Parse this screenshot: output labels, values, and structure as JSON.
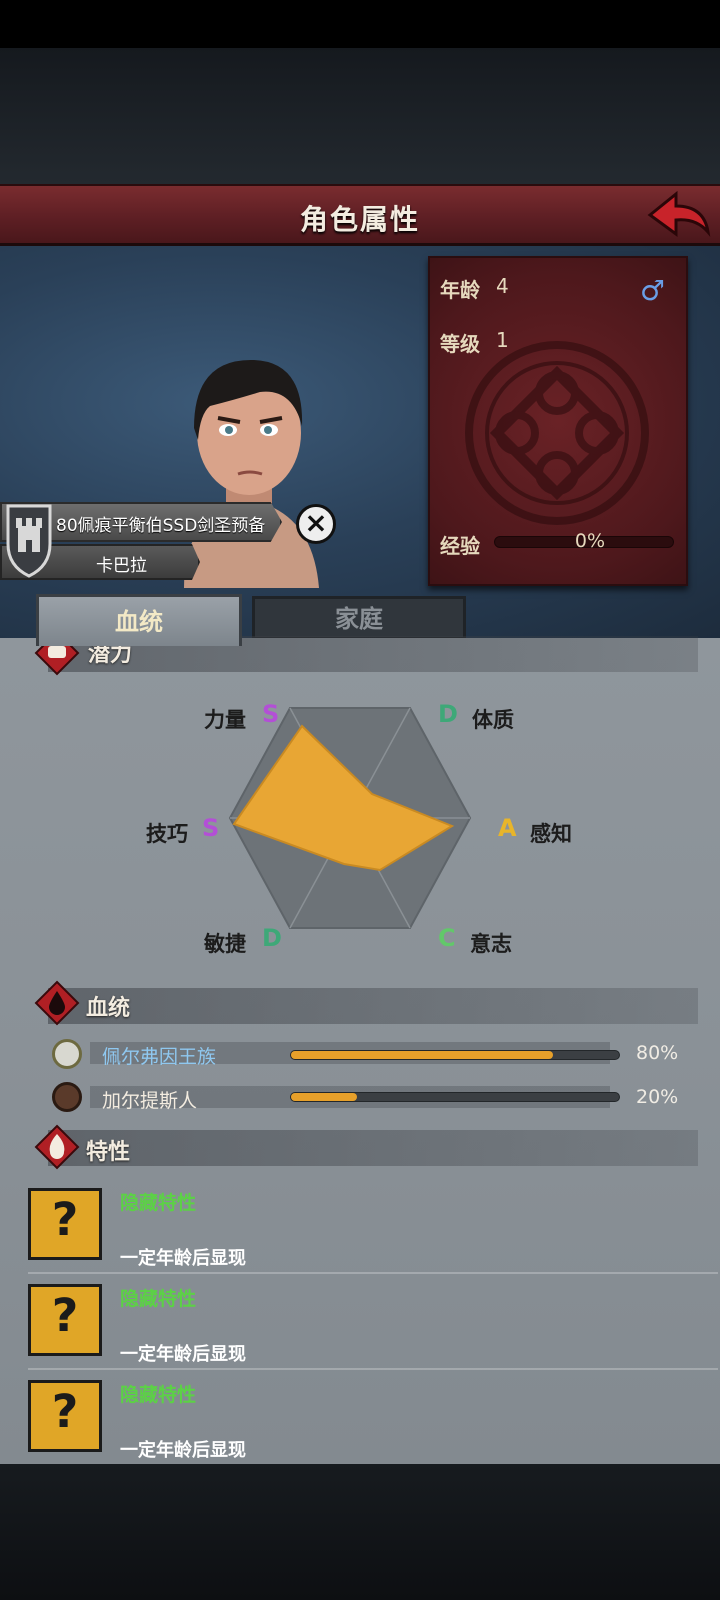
{
  "header": {
    "title": "角色属性"
  },
  "character": {
    "age_label": "年龄",
    "age_value": "4",
    "level_label": "等级",
    "level_value": "1",
    "gender_icon": "♂",
    "exp_label": "经验",
    "exp_text": "0%",
    "exp_progress": 0,
    "name": "80佩痕平衡伯SSD剑圣预备",
    "sub_name": "卡巴拉"
  },
  "tabs": [
    {
      "label": "血统"
    },
    {
      "label": "家庭"
    }
  ],
  "potential": {
    "title": "潜力",
    "attributes": [
      {
        "label": "力量",
        "grade": "S"
      },
      {
        "label": "体质",
        "grade": "D"
      },
      {
        "label": "感知",
        "grade": "A"
      },
      {
        "label": "意志",
        "grade": "C"
      },
      {
        "label": "敏捷",
        "grade": "D"
      },
      {
        "label": "技巧",
        "grade": "S"
      }
    ]
  },
  "bloodline": {
    "title": "血统",
    "items": [
      {
        "name": "佩尔弗因王族",
        "percent_text": "80%",
        "percent": 80
      },
      {
        "name": "加尔提斯人",
        "percent_text": "20%",
        "percent": 20
      }
    ]
  },
  "traits": {
    "title": "特性",
    "items": [
      {
        "title": "隐藏特性",
        "desc": "一定年龄后显现"
      },
      {
        "title": "隐藏特性",
        "desc": "一定年龄后显现"
      },
      {
        "title": "隐藏特性",
        "desc": "一定年龄后显现"
      }
    ]
  },
  "colors": {
    "accent": "#7a2c2f",
    "radar_fill": "#e8a634",
    "bar_fill": "#e7a02a"
  }
}
